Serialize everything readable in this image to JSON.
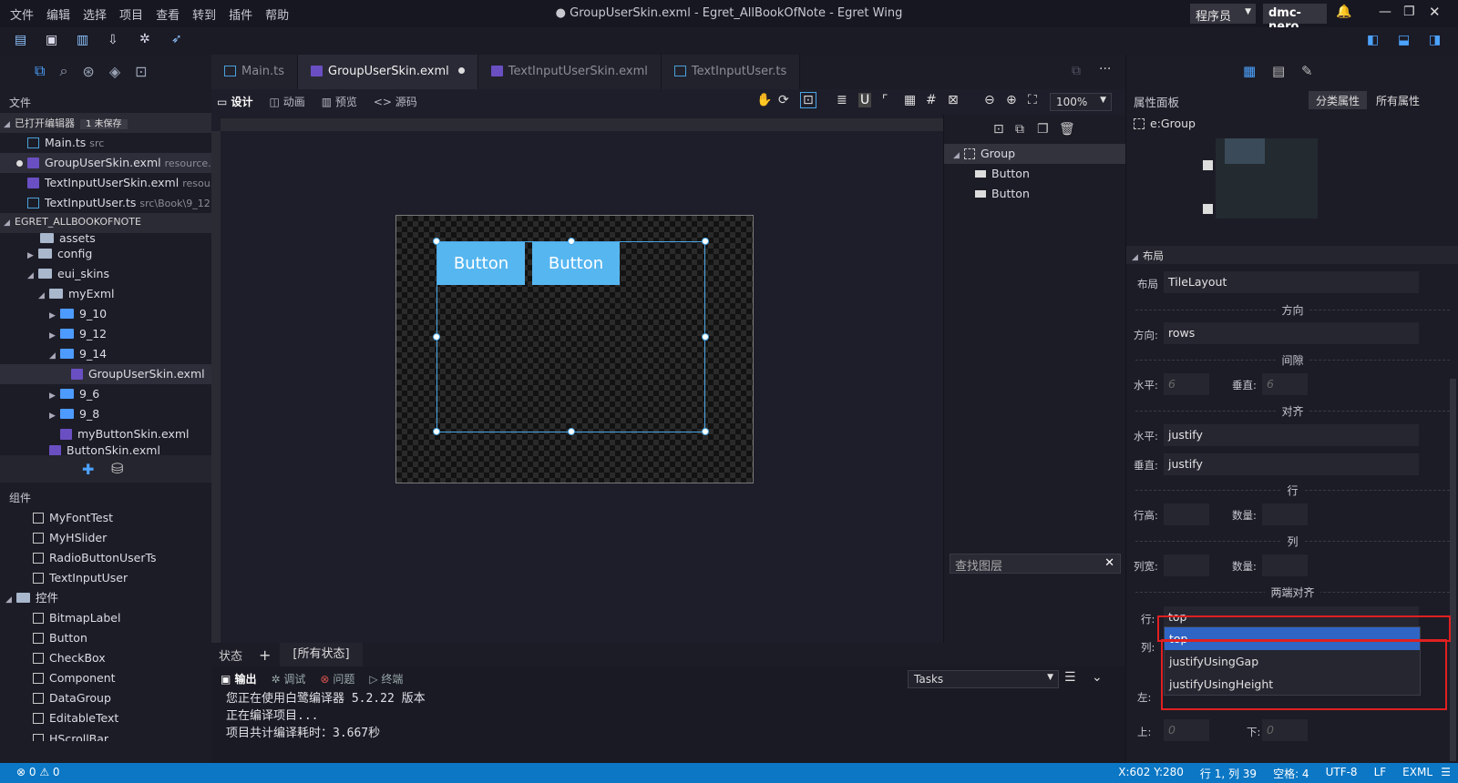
{
  "menu": [
    "文件",
    "编辑",
    "选择",
    "项目",
    "查看",
    "转到",
    "插件",
    "帮助"
  ],
  "window_title": "● GroupUserSkin.exml - Egret_AllBookOfNote - Egret Wing",
  "role": "程序员",
  "user": "dmc-nero",
  "left": {
    "files_title": "文件",
    "open_editors": {
      "label": "已打开编辑器",
      "badge": "1 未保存",
      "items": [
        {
          "name": "Main.ts",
          "path": "src"
        },
        {
          "name": "GroupUserSkin.exml",
          "path": "resource..."
        },
        {
          "name": "TextInputUserSkin.exml",
          "path": "resou..."
        },
        {
          "name": "TextInputUser.ts",
          "path": "src\\Book\\9_12"
        }
      ]
    },
    "project": {
      "label": "EGRET_ALLBOOKOFNOTE",
      "items": [
        "assets",
        "config",
        "eui_skins",
        "myExml",
        "9_10",
        "9_12",
        "9_14",
        "GroupUserSkin.exml",
        "9_6",
        "9_8",
        "myButtonSkin.exml",
        "ButtonSkin.exml"
      ]
    },
    "components_title": "组件",
    "components": [
      "MyFontTest",
      "MyHSlider",
      "RadioButtonUserTs",
      "TextInputUser"
    ],
    "controls_title": "控件",
    "controls": [
      "BitmapLabel",
      "Button",
      "CheckBox",
      "Component",
      "DataGroup",
      "EditableText",
      "HScrollBar"
    ]
  },
  "tabs": [
    {
      "label": "Main.ts"
    },
    {
      "label": "GroupUserSkin.exml"
    },
    {
      "label": "TextInputUserSkin.exml"
    },
    {
      "label": "TextInputUser.ts"
    }
  ],
  "view": {
    "design": "设计",
    "anim": "动画",
    "preview": "预览",
    "source": "<> 源码",
    "zoom": "100%"
  },
  "canvas": {
    "button1": "Button",
    "button2": "Button"
  },
  "layers": {
    "group": "Group",
    "child1": "Button",
    "child2": "Button",
    "find_placeholder": "查找图层"
  },
  "states": {
    "label": "状态",
    "add": "+",
    "all": "[所有状态]"
  },
  "output": {
    "tabs": [
      "输出",
      "调试",
      "问题",
      "终端"
    ],
    "tasks": "Tasks",
    "lines": [
      "您正在使用白鹭编译器 5.2.22 版本",
      "正在编译项目...",
      "项目共计编译耗时：3.667秒"
    ]
  },
  "props": {
    "title": "属性面板",
    "btn_category": "分类属性",
    "btn_all": "所有属性",
    "node": "e:Group",
    "layout_section": "布局",
    "layout_label": "布局",
    "layout_value": "TileLayout",
    "direction_section": "方向",
    "direction_label": "方向:",
    "direction_value": "rows",
    "gap_section": "间隙",
    "gap_h_label": "水平:",
    "gap_h": "6",
    "gap_v_label": "垂直:",
    "gap_v": "6",
    "align_section": "对齐",
    "align_h_label": "水平:",
    "align_h": "justify",
    "align_v_label": "垂直:",
    "align_v": "justify",
    "row_section": "行",
    "row_height_label": "行高:",
    "row_count_label": "数量:",
    "col_section": "列",
    "col_width_label": "列宽:",
    "col_count_label": "数量:",
    "justify_section": "两端对齐",
    "justify_row_label": "行:",
    "justify_row_value": "top",
    "justify_col_label": "列:",
    "dropdown_options": [
      "top",
      "justifyUsingGap",
      "justifyUsingHeight"
    ],
    "pad_left_label": "左:",
    "pad_top_label": "上:",
    "pad_top": "0",
    "pad_bottom_label": "下:",
    "pad_bottom": "0"
  },
  "status": {
    "errors": "⊗ 0 ⚠ 0",
    "coords": "X:602 Y:280",
    "cursor": "行 1, 列 39",
    "spaces": "空格: 4",
    "encoding": "UTF-8",
    "eol": "LF",
    "lang": "EXML"
  }
}
